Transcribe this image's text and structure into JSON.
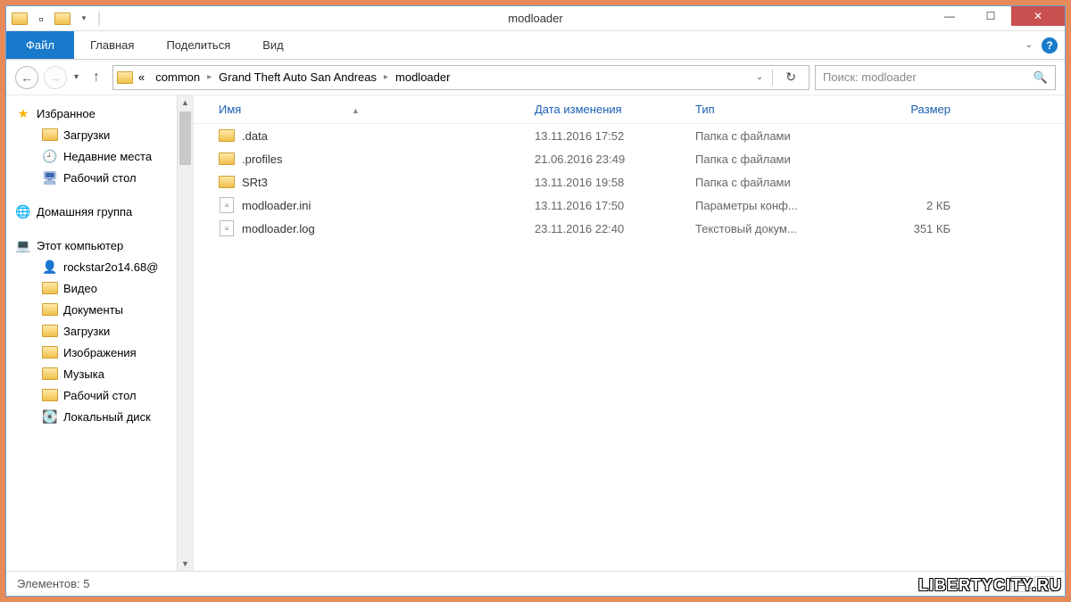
{
  "window": {
    "title": "modloader"
  },
  "ribbon": {
    "file": "Файл",
    "tabs": [
      "Главная",
      "Поделиться",
      "Вид"
    ]
  },
  "breadcrumb": {
    "prefix": "«",
    "items": [
      "common",
      "Grand Theft Auto San Andreas",
      "modloader"
    ]
  },
  "search": {
    "placeholder": "Поиск: modloader"
  },
  "sidebar": {
    "favorites": {
      "label": "Избранное",
      "items": [
        "Загрузки",
        "Недавние места",
        "Рабочий стол"
      ]
    },
    "homegroup": {
      "label": "Домашняя группа"
    },
    "computer": {
      "label": "Этот компьютер",
      "items": [
        "rockstar2o14.68@",
        "Видео",
        "Документы",
        "Загрузки",
        "Изображения",
        "Музыка",
        "Рабочий стол",
        "Локальный диск"
      ]
    }
  },
  "columns": {
    "name": "Имя",
    "date": "Дата изменения",
    "type": "Тип",
    "size": "Размер"
  },
  "files": [
    {
      "name": ".data",
      "date": "13.11.2016 17:52",
      "type": "Папка с файлами",
      "size": "",
      "icon": "folder"
    },
    {
      "name": ".profiles",
      "date": "21.06.2016 23:49",
      "type": "Папка с файлами",
      "size": "",
      "icon": "folder"
    },
    {
      "name": "SRt3",
      "date": "13.11.2016 19:58",
      "type": "Папка с файлами",
      "size": "",
      "icon": "folder"
    },
    {
      "name": "modloader.ini",
      "date": "13.11.2016 17:50",
      "type": "Параметры конф...",
      "size": "2 КБ",
      "icon": "ini"
    },
    {
      "name": "modloader.log",
      "date": "23.11.2016 22:40",
      "type": "Текстовый докум...",
      "size": "351 КБ",
      "icon": "txt"
    }
  ],
  "status": {
    "count_label": "Элементов:",
    "count": "5"
  },
  "watermark": "LIBERTYCITY.RU"
}
